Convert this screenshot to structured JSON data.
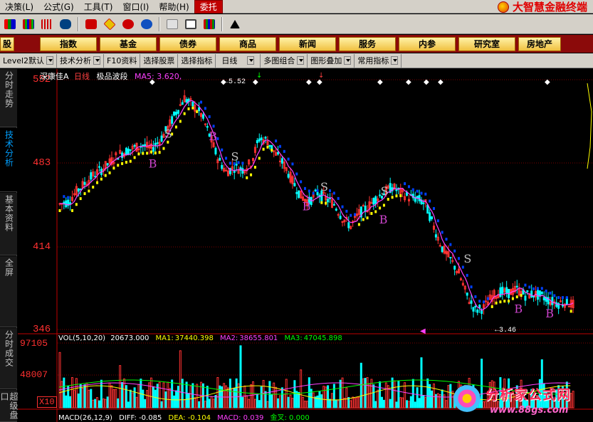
{
  "menu": {
    "items": [
      "决策(L)",
      "公式(G)",
      "工具(T)",
      "窗口(I)",
      "帮助(H)",
      "委托"
    ],
    "active": "委托"
  },
  "brand": {
    "title": "大智慧金融终端"
  },
  "categories": [
    "股",
    "指数",
    "基金",
    "债券",
    "商品",
    "新闻",
    "服务",
    "内参",
    "研究室",
    "房地产"
  ],
  "funcbar": [
    "Level2默认",
    "技术分析",
    "F10资料",
    "选择股票",
    "选择指标",
    "日线",
    "多图组合",
    "图形叠加",
    "常用指标"
  ],
  "left_tabs": [
    {
      "label": "分时走势",
      "active": false
    },
    {
      "label": "技术分析",
      "active": true
    },
    {
      "label": "基本资料",
      "active": false
    },
    {
      "label": "全屏",
      "active": false
    },
    {
      "label": "分时成交",
      "active": false
    },
    {
      "label": "超级盘口",
      "active": false
    }
  ],
  "chart": {
    "stock": "深康佳A",
    "period": "日线",
    "indicator": "极品波段",
    "ma_label": "MA5: 3.620,",
    "high_label": "5.52",
    "low_label": "3.46",
    "y_labels": [
      "552",
      "483",
      "414",
      "346"
    ],
    "signals_S": [
      "S",
      "S",
      "S",
      "S",
      "S"
    ],
    "signals_B": [
      "B",
      "B",
      "B",
      "B",
      "B",
      "B"
    ]
  },
  "volume": {
    "title": "VOL(5,10,20)",
    "value": "20673.000",
    "ma1_label": "MA1:",
    "ma1": "37440.398",
    "ma2_label": "MA2:",
    "ma2": "38655.801",
    "ma3_label": "MA3:",
    "ma3": "47045.898",
    "y_labels": [
      "97105",
      "48007"
    ],
    "unit": "X10"
  },
  "macd": {
    "title": "MACD(26,12,9)",
    "diff": "DIFF: -0.085",
    "dea": "DEA: -0.104",
    "macd": "MACD: 0.039",
    "extra": "金叉: 0.000"
  },
  "watermark": {
    "title": "分析家公式网",
    "url": "www.88gs.com"
  },
  "colors": {
    "up": "#ff3232",
    "down": "#00ffff",
    "ma": "#ff40ff",
    "sell": "#c0c0c0",
    "buy": "#cc44cc",
    "axis": "#ff3030"
  },
  "chart_data": {
    "type": "candlestick",
    "title": "深康佳A 日线 极品波段",
    "y_axis_labels": [
      552,
      483,
      414,
      346
    ],
    "high": 5.52,
    "low": 3.46,
    "ma5": 3.62,
    "close_series": [
      4.5,
      4.52,
      4.61,
      4.68,
      4.75,
      4.8,
      4.86,
      4.93,
      4.96,
      4.99,
      5.01,
      4.98,
      5.05,
      5.16,
      5.3,
      5.42,
      5.36,
      5.28,
      5.1,
      4.9,
      4.78,
      4.82,
      4.8,
      4.86,
      5.07,
      5.05,
      4.93,
      4.84,
      4.7,
      4.57,
      4.52,
      4.6,
      4.55,
      4.5,
      4.38,
      4.31,
      4.42,
      4.47,
      4.55,
      4.6,
      4.65,
      4.6,
      4.56,
      4.55,
      4.5,
      4.3,
      4.12,
      4.02,
      3.9,
      3.7,
      3.58,
      3.6,
      3.7,
      3.74,
      3.73,
      3.76,
      3.71,
      3.72,
      3.7,
      3.66,
      3.64,
      3.65,
      3.62
    ]
  }
}
